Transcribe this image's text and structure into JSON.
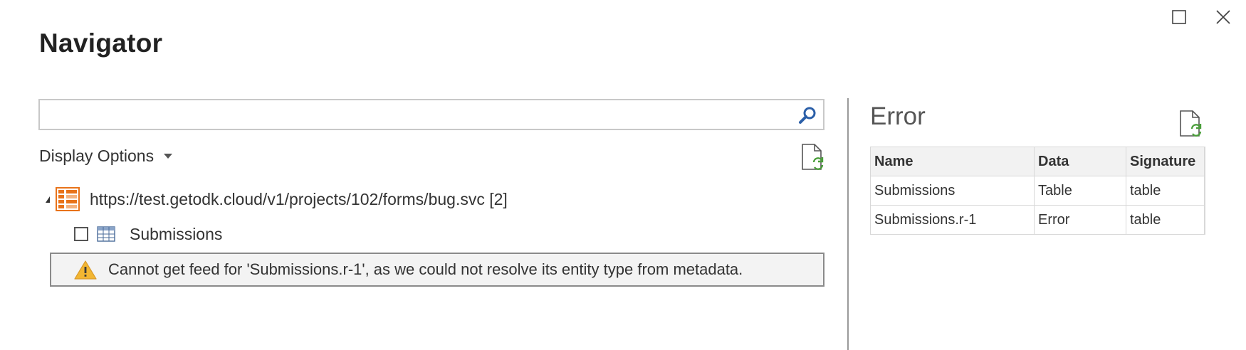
{
  "window": {
    "title": "Navigator"
  },
  "search": {
    "value": "",
    "placeholder": ""
  },
  "display_options": {
    "label": "Display Options"
  },
  "tree": {
    "root": {
      "label": "https://test.getodk.cloud/v1/projects/102/forms/bug.svc [2]",
      "icon": "odata-feed-icon",
      "expanded": true
    },
    "children": [
      {
        "label": "Submissions",
        "icon": "table-icon",
        "checked": false
      }
    ]
  },
  "warning": {
    "icon": "warning-icon",
    "text": "Cannot get feed for 'Submissions.r-1', as we could not resolve its entity type from metadata."
  },
  "preview": {
    "title": "Error",
    "columns": [
      "Name",
      "Data",
      "Signature"
    ],
    "rows": [
      [
        "Submissions",
        "Table",
        "table"
      ],
      [
        "Submissions.r-1",
        "Error",
        "table"
      ]
    ]
  },
  "colors": {
    "accent_orange": "#e8731a",
    "refresh_green": "#4a9e3a",
    "search_blue": "#2b5fa8",
    "warning_yellow": "#f2b632"
  }
}
